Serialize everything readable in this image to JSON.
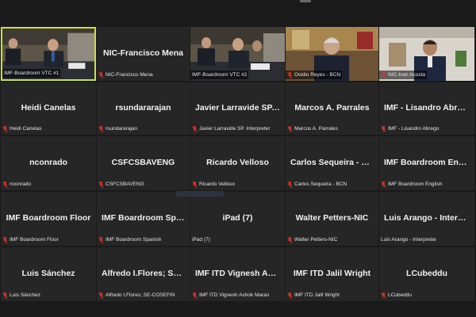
{
  "meeting": {
    "participants": [
      {
        "tile": "IMF-Boardroom VTC #1",
        "label": "IMF-Boardroom VTC #1",
        "muted": false,
        "video": true,
        "active": true
      },
      {
        "tile": "NIC-Francisco Mena",
        "label": "NIC-Francisco Mena",
        "muted": true,
        "video": false
      },
      {
        "tile": "IMF-Boardroom VTC #2",
        "label": "IMF-Boardroom VTC #2",
        "muted": false,
        "video": true
      },
      {
        "tile": "Ovidio Reyes - BCN",
        "label": "Ovidio Reyes - BCN",
        "muted": true,
        "video": true
      },
      {
        "tile": "NIC-Ivan Acosta",
        "label": "NIC-Ivan Acosta",
        "muted": true,
        "video": true
      },
      {
        "tile": "Heidi Canelas",
        "label": "Heidi Canelas",
        "muted": true,
        "video": false
      },
      {
        "tile": "rsundararajan",
        "label": "rsundararajan",
        "muted": true,
        "video": false
      },
      {
        "tile": "Javier Larravide SP. Interpreter",
        "label": "Javier Larravide SP. Interpreter",
        "muted": true,
        "video": false
      },
      {
        "tile": "Marcos A. Parrales",
        "label": "Marcos A. Parrales",
        "muted": true,
        "video": false
      },
      {
        "tile": "IMF - Lisandro Abrego",
        "label": "IMF - Lisandro Abrego",
        "muted": true,
        "video": false
      },
      {
        "tile": "nconrado",
        "label": "nconrado",
        "muted": true,
        "video": false
      },
      {
        "tile": "CSFCSBAVENG",
        "label": "CSFCSBAVENG",
        "muted": true,
        "video": false
      },
      {
        "tile": "Ricardo Velloso",
        "label": "Ricardo Velloso",
        "muted": true,
        "video": false
      },
      {
        "tile": "Carlos Sequeira - BCN",
        "label": "Carlos Sequeira - BCN",
        "muted": true,
        "video": false
      },
      {
        "tile": "IMF Boardroom English",
        "label": "IMF Boardroom English",
        "muted": true,
        "video": false
      },
      {
        "tile": "IMF Boardroom Floor",
        "label": "IMF Boardroom Floor",
        "muted": true,
        "video": false
      },
      {
        "tile": "IMF Boardroom Spanish",
        "label": "IMF Boardroom Spanish",
        "muted": true,
        "video": false
      },
      {
        "tile": "iPad (7)",
        "label": "iPad (7)",
        "muted": false,
        "video": false
      },
      {
        "tile": "Walter Petters-NIC",
        "label": "Walter Petters-NIC",
        "muted": true,
        "video": false
      },
      {
        "tile": "Luis Arango - Interpreter",
        "label": "Luis Arango - Interpreter",
        "muted": false,
        "video": false
      },
      {
        "tile": "Luis Sánchez",
        "label": "Luis Sánchez",
        "muted": true,
        "video": false
      },
      {
        "tile": "Alfredo I.Flores; SE-COSEFIN",
        "label": "Alfredo I.Flores; SE-COSEFIN",
        "muted": true,
        "video": false
      },
      {
        "tile": "IMF ITD Vignesh Ashok Maran",
        "label": "IMF ITD Vignesh Ashok Maran",
        "muted": true,
        "video": false
      },
      {
        "tile": "IMF ITD Jalil Wright",
        "label": "IMF ITD Jalil Wright",
        "muted": true,
        "video": false
      },
      {
        "tile": "LCubeddu",
        "label": "LCubeddu",
        "muted": true,
        "video": false
      }
    ]
  },
  "icons": {
    "muted": "mic-muted-icon"
  },
  "colors": {
    "background": "#1a1a1a",
    "tile": "#262626",
    "active_speaker_border": "#c9e23a",
    "muted_icon": "#e0322b"
  }
}
